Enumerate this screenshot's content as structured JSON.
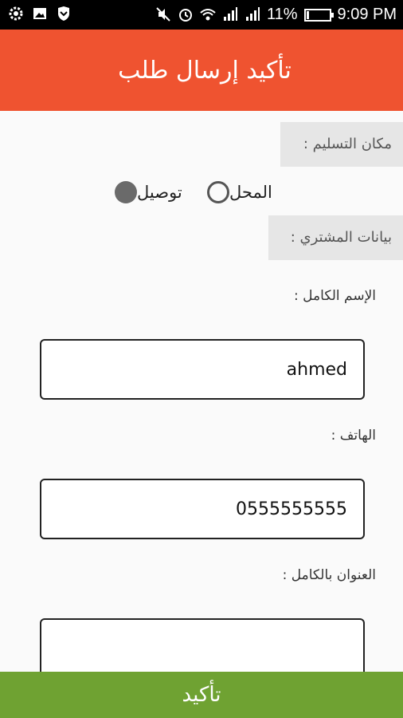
{
  "status_bar": {
    "battery_percent": "11%",
    "time": "9:09 PM",
    "battery_level": 0.11,
    "left_icons": [
      "gear-icon",
      "image-icon",
      "shield-icon"
    ],
    "right_icons": [
      "mute-icon",
      "alarm-icon",
      "wifi-icon",
      "signal-icon",
      "signal-icon"
    ]
  },
  "app_bar": {
    "title": "تأكيد إرسال طلب",
    "color": "#ef5330"
  },
  "delivery": {
    "section_label": "مكان التسليم :",
    "options": [
      {
        "label": "المحل",
        "selected": false
      },
      {
        "label": "توصيل",
        "selected": true
      }
    ]
  },
  "buyer": {
    "section_label": "بيانات المشتري :",
    "name_label": "الإسم الكامل :",
    "name_value": "ahmed",
    "phone_label": "الهاتف :",
    "phone_value": "0555555555",
    "address_label": "العنوان بالكامل :",
    "address_value": ""
  },
  "confirm": {
    "label": "تأكيد",
    "color": "#6fa232"
  }
}
